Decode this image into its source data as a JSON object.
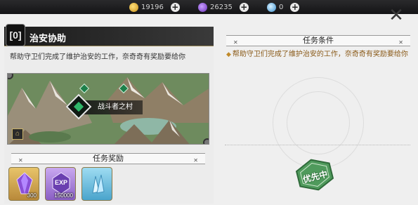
{
  "topbar": {
    "resources": [
      {
        "icon": "gold-coin-icon",
        "value": "19196",
        "color": "#d9a421"
      },
      {
        "icon": "purple-gem-icon",
        "value": "26235",
        "color": "#8a4fd6"
      },
      {
        "icon": "crystal-icon",
        "value": "0",
        "color": "#6ec6ff"
      }
    ],
    "plus_label": "+"
  },
  "close_label": "✕",
  "quest": {
    "emblem": "[0]",
    "title": "治安协助",
    "description": "帮助守卫们完成了维护治安的工作，奈奇奇有奖励要给你",
    "location": "战斗者之村"
  },
  "rewards_section": {
    "title": "任务奖励",
    "items": [
      {
        "name": "purple-crystal",
        "qty": "300",
        "bg": "#d8b15a"
      },
      {
        "name": "exp-crystal",
        "label": "EXP",
        "qty": "150000",
        "bg": "#b490e0"
      },
      {
        "name": "blue-crystal",
        "qty": "",
        "bg": "#79c7e8"
      }
    ]
  },
  "conditions": {
    "title": "任务条件",
    "text": "帮助守卫们完成了维护治安的工作，奈奇奇有奖励要给你"
  },
  "stamp": {
    "text": "优先中",
    "color": "#4f9a5c"
  }
}
